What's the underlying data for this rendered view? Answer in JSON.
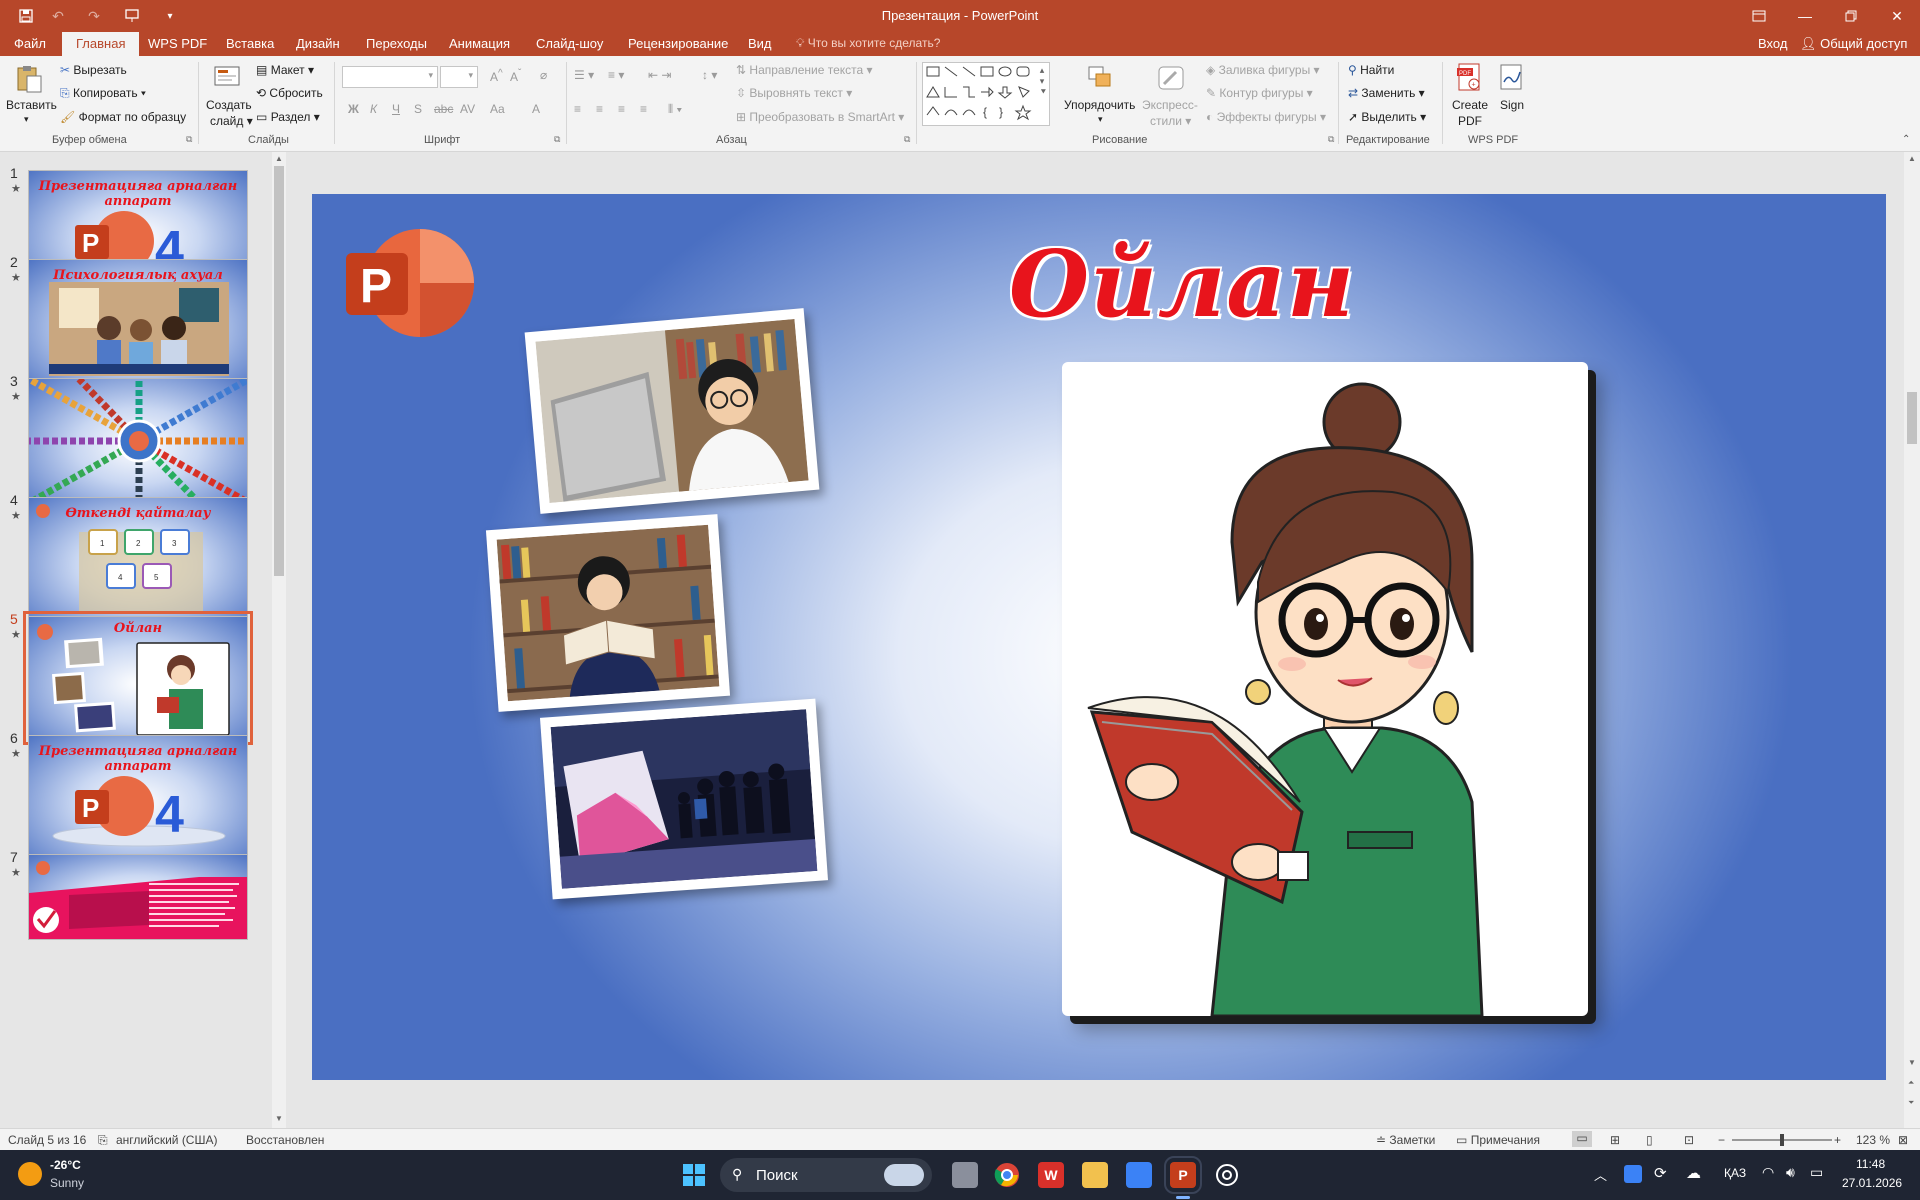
{
  "titlebar": {
    "title": "Презентация - PowerPoint",
    "qa_icons": [
      "save-icon",
      "undo-icon",
      "redo-icon",
      "present-icon",
      "customize-icon"
    ],
    "controls": [
      "ribbon-display-icon",
      "minimize-icon",
      "restore-icon",
      "close-icon"
    ]
  },
  "tabs": [
    "Файл",
    "Главная",
    "WPS PDF",
    "Вставка",
    "Дизайн",
    "Переходы",
    "Анимация",
    "Слайд-шоу",
    "Рецензирование",
    "Вид"
  ],
  "active_tab": "Главная",
  "tell_me": "Что вы хотите сделать?",
  "signin": "Вход",
  "share": "Общий доступ",
  "ribbon": {
    "clipboard": {
      "paste": "Вставить",
      "cut": "Вырезать",
      "copy": "Копировать",
      "format_painter": "Формат по образцу",
      "label": "Буфер обмена"
    },
    "slides": {
      "new_slide_1": "Создать",
      "new_slide_2": "слайд",
      "layout": "Макет",
      "reset": "Сбросить",
      "section": "Раздел",
      "label": "Слайды"
    },
    "font": {
      "label": "Шрифт",
      "bold": "Ж",
      "italic": "К",
      "underline": "Ч",
      "strike": "S",
      "spacing": "AV",
      "case": "Aa",
      "color": "A"
    },
    "paragraph": {
      "text_direction": "Направление текста",
      "align_text": "Выровнять текст",
      "smartart": "Преобразовать в SmartArt",
      "label": "Абзац"
    },
    "drawing": {
      "arrange": "Упорядочить",
      "quick_styles_1": "Экспресс-",
      "quick_styles_2": "стили",
      "fill": "Заливка фигуры",
      "outline": "Контур фигуры",
      "effects": "Эффекты фигуры",
      "label": "Рисование"
    },
    "editing": {
      "find": "Найти",
      "replace": "Заменить",
      "select": "Выделить",
      "label": "Редактирование"
    },
    "wps": {
      "create_pdf_1": "Create",
      "create_pdf_2": "PDF",
      "sign": "Sign",
      "label": "WPS PDF"
    }
  },
  "thumbnails": [
    {
      "num": "1",
      "title": "Презентацияға арналған аппарат",
      "active": false
    },
    {
      "num": "2",
      "title": "Психологиялық ахуал",
      "active": false
    },
    {
      "num": "3",
      "title": "",
      "active": false
    },
    {
      "num": "4",
      "title": "Өткенді қайталау",
      "active": false
    },
    {
      "num": "5",
      "title": "Ойлан",
      "active": true
    },
    {
      "num": "6",
      "title": "Презентацияға арналған аппарат",
      "active": false
    },
    {
      "num": "7",
      "title": "",
      "active": false
    }
  ],
  "slide": {
    "title": "Ойлан"
  },
  "status": {
    "slide_of": "Слайд 5 из 16",
    "language": "английский (США)",
    "recovered": "Восстановлен",
    "notes": "Заметки",
    "comments": "Примечания",
    "zoom": "123 %"
  },
  "taskbar": {
    "temp": "-26°C",
    "weather": "Sunny",
    "search": "Поиск",
    "lang": "ҚАЗ",
    "time": "11:48",
    "date": "27.01.2026"
  },
  "colors": {
    "accent": "#b7472a",
    "title_red": "#e8141c",
    "slide_blue": "#4a6fc2"
  }
}
